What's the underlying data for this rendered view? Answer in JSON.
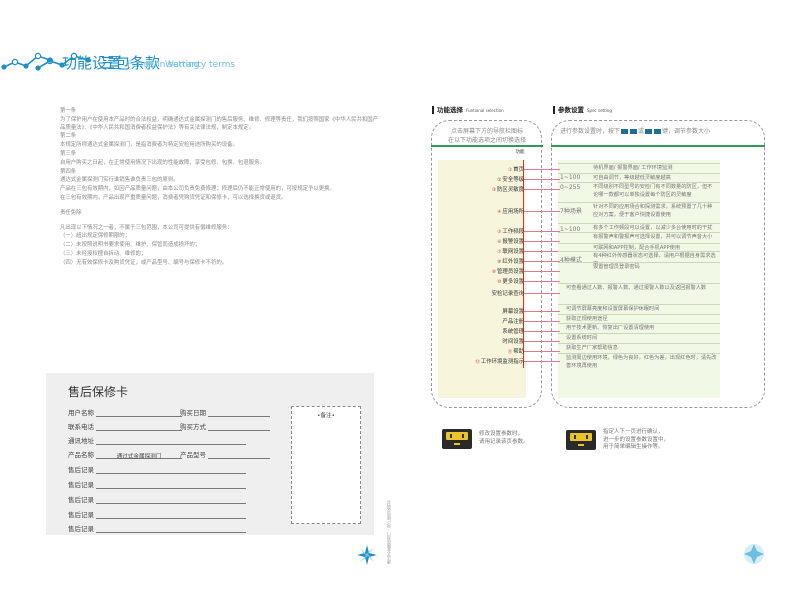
{
  "left": {
    "heading": {
      "cn": "三包条款",
      "en": "Warranty terms"
    },
    "paragraphs": [
      "第一条",
      "    为了保护用户在使用本产品时的合法权益，明确通达式金属探测门的售后服务、维修、修理等责任，我们按照国家《中华人民共和国产品质量法》、《中华人民共和国消费者权益保护法》等有关法律法规，制定本规定。",
      "第二条",
      "本规定所称通达式金属探测门，是指消费者为特定安检用途所购买的设备。",
      "第三条",
      "自用户购买之日起，在正常使用情况下出现的性能故障，享受包修、包换、包退服务。",
      "第四条",
      "通达式金属探测门实行谁销售谁负责三包的原则。",
      "产品在三包有效期内，如因产品质量问题，由本公司负责免费修理；修理后仍不能正常使用的，可按规定予以更换。",
      "在三包有效期内，产品出现严重质量问题，消费者凭购货凭证和保修卡，可以选择换货或退货。",
      "",
      "责任免除",
      "",
      "凡出现以下情况之一者，不属于三包范围，本公司可提供有偿维修服务：",
      "（一）超出规定保修期限的；",
      "（二）未按照说明书要求使用、维护、保管而造成损坏的；",
      "（三）未经授权擅自拆动、维修的；",
      "（四）无有效保修卡及购货凭证，或产品型号、编号与保修卡不符的。"
    ],
    "card": {
      "title": "售后保修卡",
      "user_name": "用户名称",
      "buy_date": "购买日期",
      "contact": "联系电话",
      "buy_method": "购买方式",
      "address": "通讯地址",
      "product_name": "产品名称",
      "product_name_value": "通过式金属探测门",
      "product_model": "产品型号",
      "records": [
        "售后记录",
        "售后记录",
        "售后记录",
        "售后记录",
        "售后记录"
      ],
      "note": "•备注•"
    },
    "spine": "通达式金属探测门 · 用户使用说明书"
  },
  "right": {
    "heading": {
      "cn": "功能设置",
      "en": "Function setting"
    },
    "label_a": {
      "cn": "功能选择",
      "en": "Funtional selection"
    },
    "label_b": {
      "cn": "参数设置",
      "en": "Spec setting"
    },
    "intro_a": [
      "点击屏幕下方的导航栏图标",
      "在以下功能选项之间切换选择"
    ],
    "intro_b_pre": "进行参数设置时，按下",
    "intro_b_or": "或",
    "intro_b_post": "键，调节参数大小",
    "col_head": "功能",
    "menu": [
      {
        "label": "首页",
        "num": "①"
      },
      {
        "label": "安全等级",
        "num": "②"
      },
      {
        "label": "防区灵敏度",
        "num": "③"
      },
      {
        "label": "应用场所",
        "num": "④"
      },
      {
        "label": "工作频段",
        "num": "⑤"
      },
      {
        "label": "报警设置",
        "num": "⑥"
      },
      {
        "label": "联网设置",
        "num": "⑦"
      },
      {
        "label": "红外设置",
        "num": "⑧"
      },
      {
        "label": "管理员设置",
        "num": "⑨"
      },
      {
        "label": "更多设置",
        "num": "⑩"
      },
      {
        "label": "安检记录查询",
        "num": ""
      },
      {
        "label": "屏幕设置",
        "num": ""
      },
      {
        "label": "产品注册",
        "num": ""
      },
      {
        "label": "系统管理",
        "num": ""
      },
      {
        "label": "时间设置",
        "num": ""
      },
      {
        "label": "帮助",
        "num": "⑪"
      },
      {
        "label": "工作环境监测指示",
        "num": "⑫"
      }
    ],
    "ranges": [
      "1~100",
      "0~255",
      "7种场景",
      "1~100",
      "4种模式"
    ],
    "descs": [
      "待机界面/ 报警界面/ 工作环境监测",
      "可自由调节，等级越低灵敏度越高",
      "不同级别不同型号的安检门有不同数量的防区，但不论哪一款都可以单独设置每个防区的灵敏度",
      "针对不同的应用场合和探测需求，系统预置了几十种应对方案，便于客户快捷设置使用",
      "有多个工作频段可以设置，以减少多台使用时的干扰",
      "有报警声和警报声可选择设置，并可以调节声音大小",
      "可联网和APP控制，配合手机APP使用",
      "有4种红外传感器状态可选择，请用户根据自身需求选用",
      "设置管理员登录密码",
      "可查看通过人数、报警人数、通过报警人数以及返回报警人数",
      "可调节屏幕亮度和设置屏幕保护休眠时间",
      "获取正规使用途径",
      "用于技术更新、恢复出厂设置清理使用",
      "设置系统时间",
      "获取生产厂家帮助信息",
      "监测周边使用环境，绿色为良好，红色为差，出现红色时，请先改善环境再使用"
    ],
    "legend_a": [
      "修改设置参数时，",
      "请用记录该页参数。"
    ],
    "legend_b": [
      "指定人下一页进行确认，",
      "进一步的设置参数设置中，",
      "用于简单编辑生操作等。"
    ]
  },
  "colors": {
    "accent": "#1f8fc4",
    "green": "#2f9a55",
    "red": "#d1313d",
    "key": "#e9c42a"
  }
}
